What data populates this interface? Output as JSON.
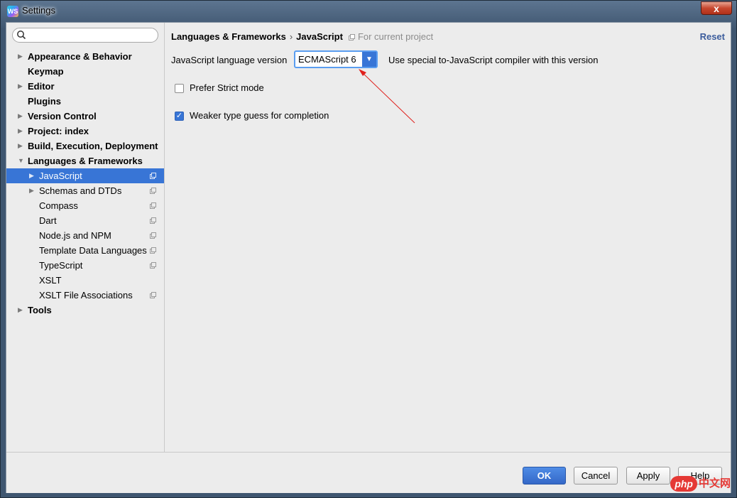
{
  "window": {
    "title": "Settings",
    "close_glyph": "x"
  },
  "search": {
    "placeholder": "",
    "value": ""
  },
  "sidebar": {
    "items": [
      {
        "label": "Appearance & Behavior",
        "level": 0,
        "arrow": "right"
      },
      {
        "label": "Keymap",
        "level": 0,
        "arrow": "none"
      },
      {
        "label": "Editor",
        "level": 0,
        "arrow": "right"
      },
      {
        "label": "Plugins",
        "level": 0,
        "arrow": "none"
      },
      {
        "label": "Version Control",
        "level": 0,
        "arrow": "right"
      },
      {
        "label": "Project: index",
        "level": 0,
        "arrow": "right"
      },
      {
        "label": "Build, Execution, Deployment",
        "level": 0,
        "arrow": "right"
      },
      {
        "label": "Languages & Frameworks",
        "level": 0,
        "arrow": "down"
      },
      {
        "label": "JavaScript",
        "level": 1,
        "arrow": "right",
        "selected": true,
        "project_icon": true
      },
      {
        "label": "Schemas and DTDs",
        "level": 1,
        "arrow": "right",
        "project_icon": true
      },
      {
        "label": "Compass",
        "level": 1,
        "arrow": "none",
        "project_icon": true
      },
      {
        "label": "Dart",
        "level": 1,
        "arrow": "none",
        "project_icon": true
      },
      {
        "label": "Node.js and NPM",
        "level": 1,
        "arrow": "none",
        "project_icon": true
      },
      {
        "label": "Template Data Languages",
        "level": 1,
        "arrow": "none",
        "project_icon": true
      },
      {
        "label": "TypeScript",
        "level": 1,
        "arrow": "none",
        "project_icon": true
      },
      {
        "label": "XSLT",
        "level": 1,
        "arrow": "none",
        "project_icon": false
      },
      {
        "label": "XSLT File Associations",
        "level": 1,
        "arrow": "none",
        "project_icon": true
      },
      {
        "label": "Tools",
        "level": 0,
        "arrow": "right"
      }
    ]
  },
  "breadcrumb": {
    "parent": "Languages & Frameworks",
    "separator": "›",
    "current": "JavaScript",
    "scope": "For current project"
  },
  "reset_label": "Reset",
  "js_version": {
    "label": "JavaScript language version",
    "selected": "ECMAScript 6",
    "description": "Use special to-JavaScript compiler with this version"
  },
  "options": [
    {
      "label": "Prefer Strict mode",
      "checked": false
    },
    {
      "label": "Weaker type guess for completion",
      "checked": true
    }
  ],
  "buttons": {
    "ok": "OK",
    "cancel": "Cancel",
    "apply": "Apply",
    "help": "Help"
  },
  "watermark": {
    "php": "php",
    "zh": "中文网"
  },
  "colors": {
    "selection": "#3875d6",
    "annotation_arrow": "#e0201c",
    "reset_link": "#3b5c9c"
  }
}
